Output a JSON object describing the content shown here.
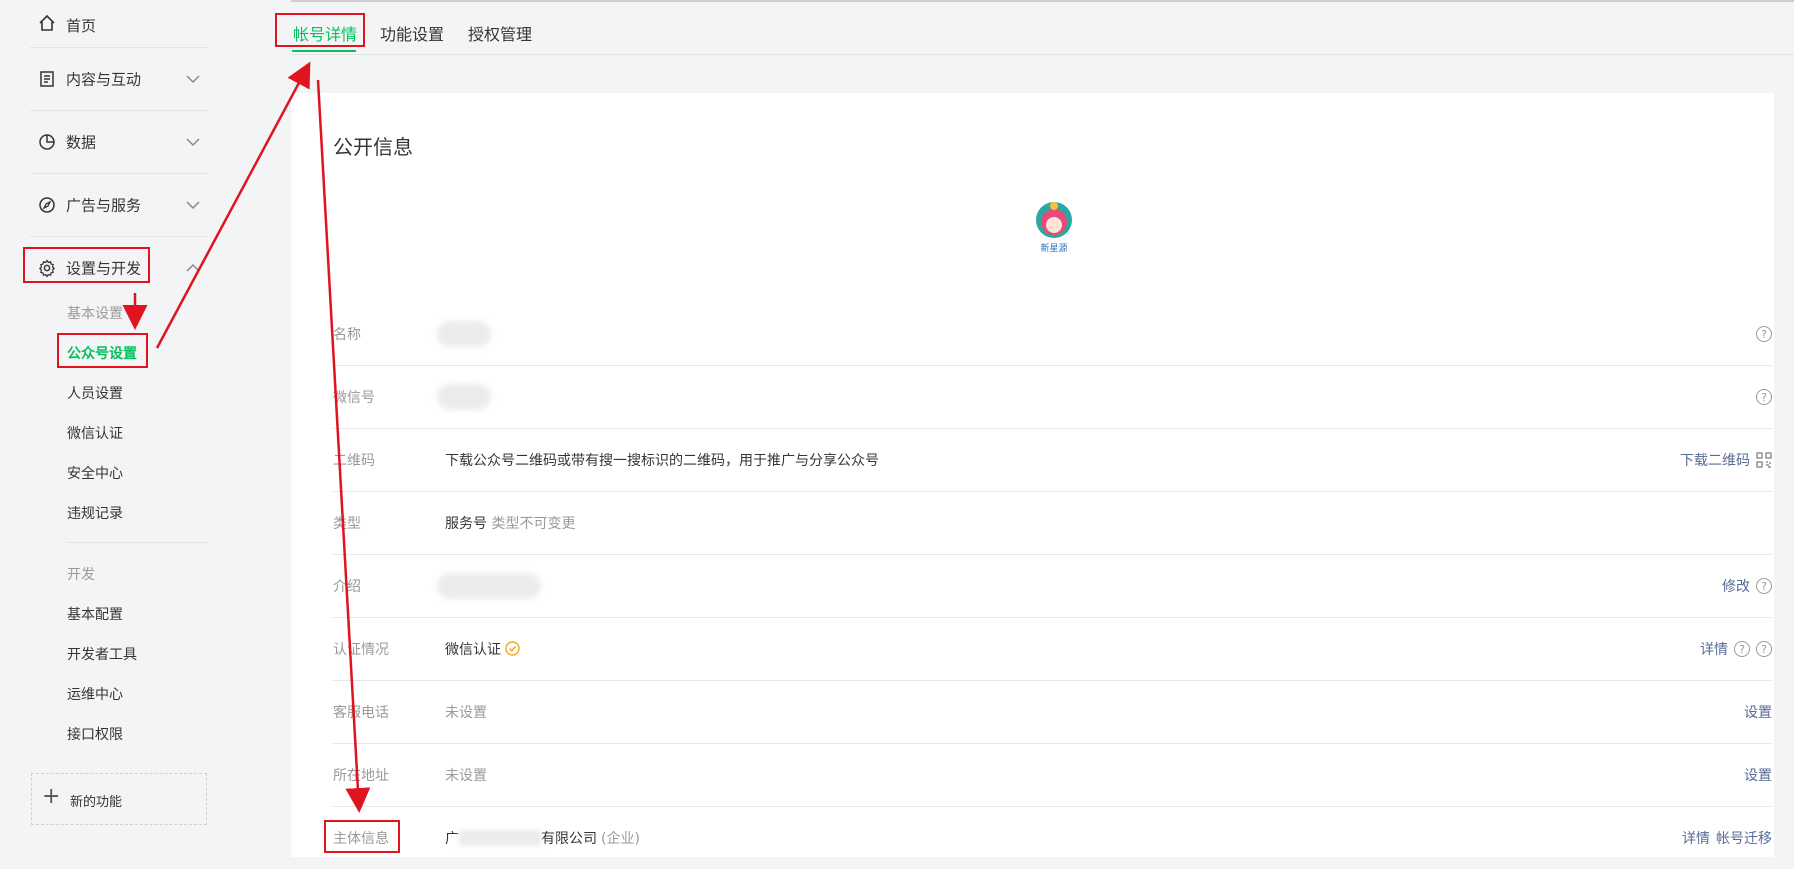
{
  "sidebar": {
    "home": "首页",
    "groups": [
      "内容与互动",
      "数据",
      "广告与服务",
      "设置与开发"
    ],
    "basic_section": "基本设置",
    "basic_items": [
      "公众号设置",
      "人员设置",
      "微信认证",
      "安全中心",
      "违规记录"
    ],
    "dev_section": "开发",
    "dev_items": [
      "基本配置",
      "开发者工具",
      "运维中心",
      "接口权限"
    ],
    "new_feature": "新的功能"
  },
  "tabs": [
    "帐号详情",
    "功能设置",
    "授权管理"
  ],
  "main": {
    "section_title": "公开信息",
    "avatar_text": "新星源",
    "rows": [
      {
        "key": "名称",
        "value": "",
        "actions": []
      },
      {
        "key": "微信号",
        "value": "",
        "actions": []
      },
      {
        "key": "二维码",
        "value": "下载公众号二维码或带有搜一搜标识的二维码，用于推广与分享公众号",
        "actions": [
          "下载二维码"
        ]
      },
      {
        "key": "类型",
        "value": "服务号",
        "note": "类型不可变更",
        "actions": []
      },
      {
        "key": "介绍",
        "value": "",
        "actions": [
          "修改"
        ]
      },
      {
        "key": "认证情况",
        "value": "微信认证",
        "actions": [
          "详情"
        ]
      },
      {
        "key": "客服电话",
        "value": "未设置",
        "actions": [
          "设置"
        ]
      },
      {
        "key": "所在地址",
        "value": "未设置",
        "actions": [
          "设置"
        ]
      },
      {
        "key": "主体信息",
        "value_prefix": "广",
        "value_suffix": "有限公司",
        "note": "(企业)",
        "actions": [
          "详情",
          "帐号迁移"
        ]
      }
    ]
  },
  "colors": {
    "accent": "#07c160",
    "link": "#576b95",
    "annotation": "#e0141e",
    "badge": "#f5a623"
  }
}
